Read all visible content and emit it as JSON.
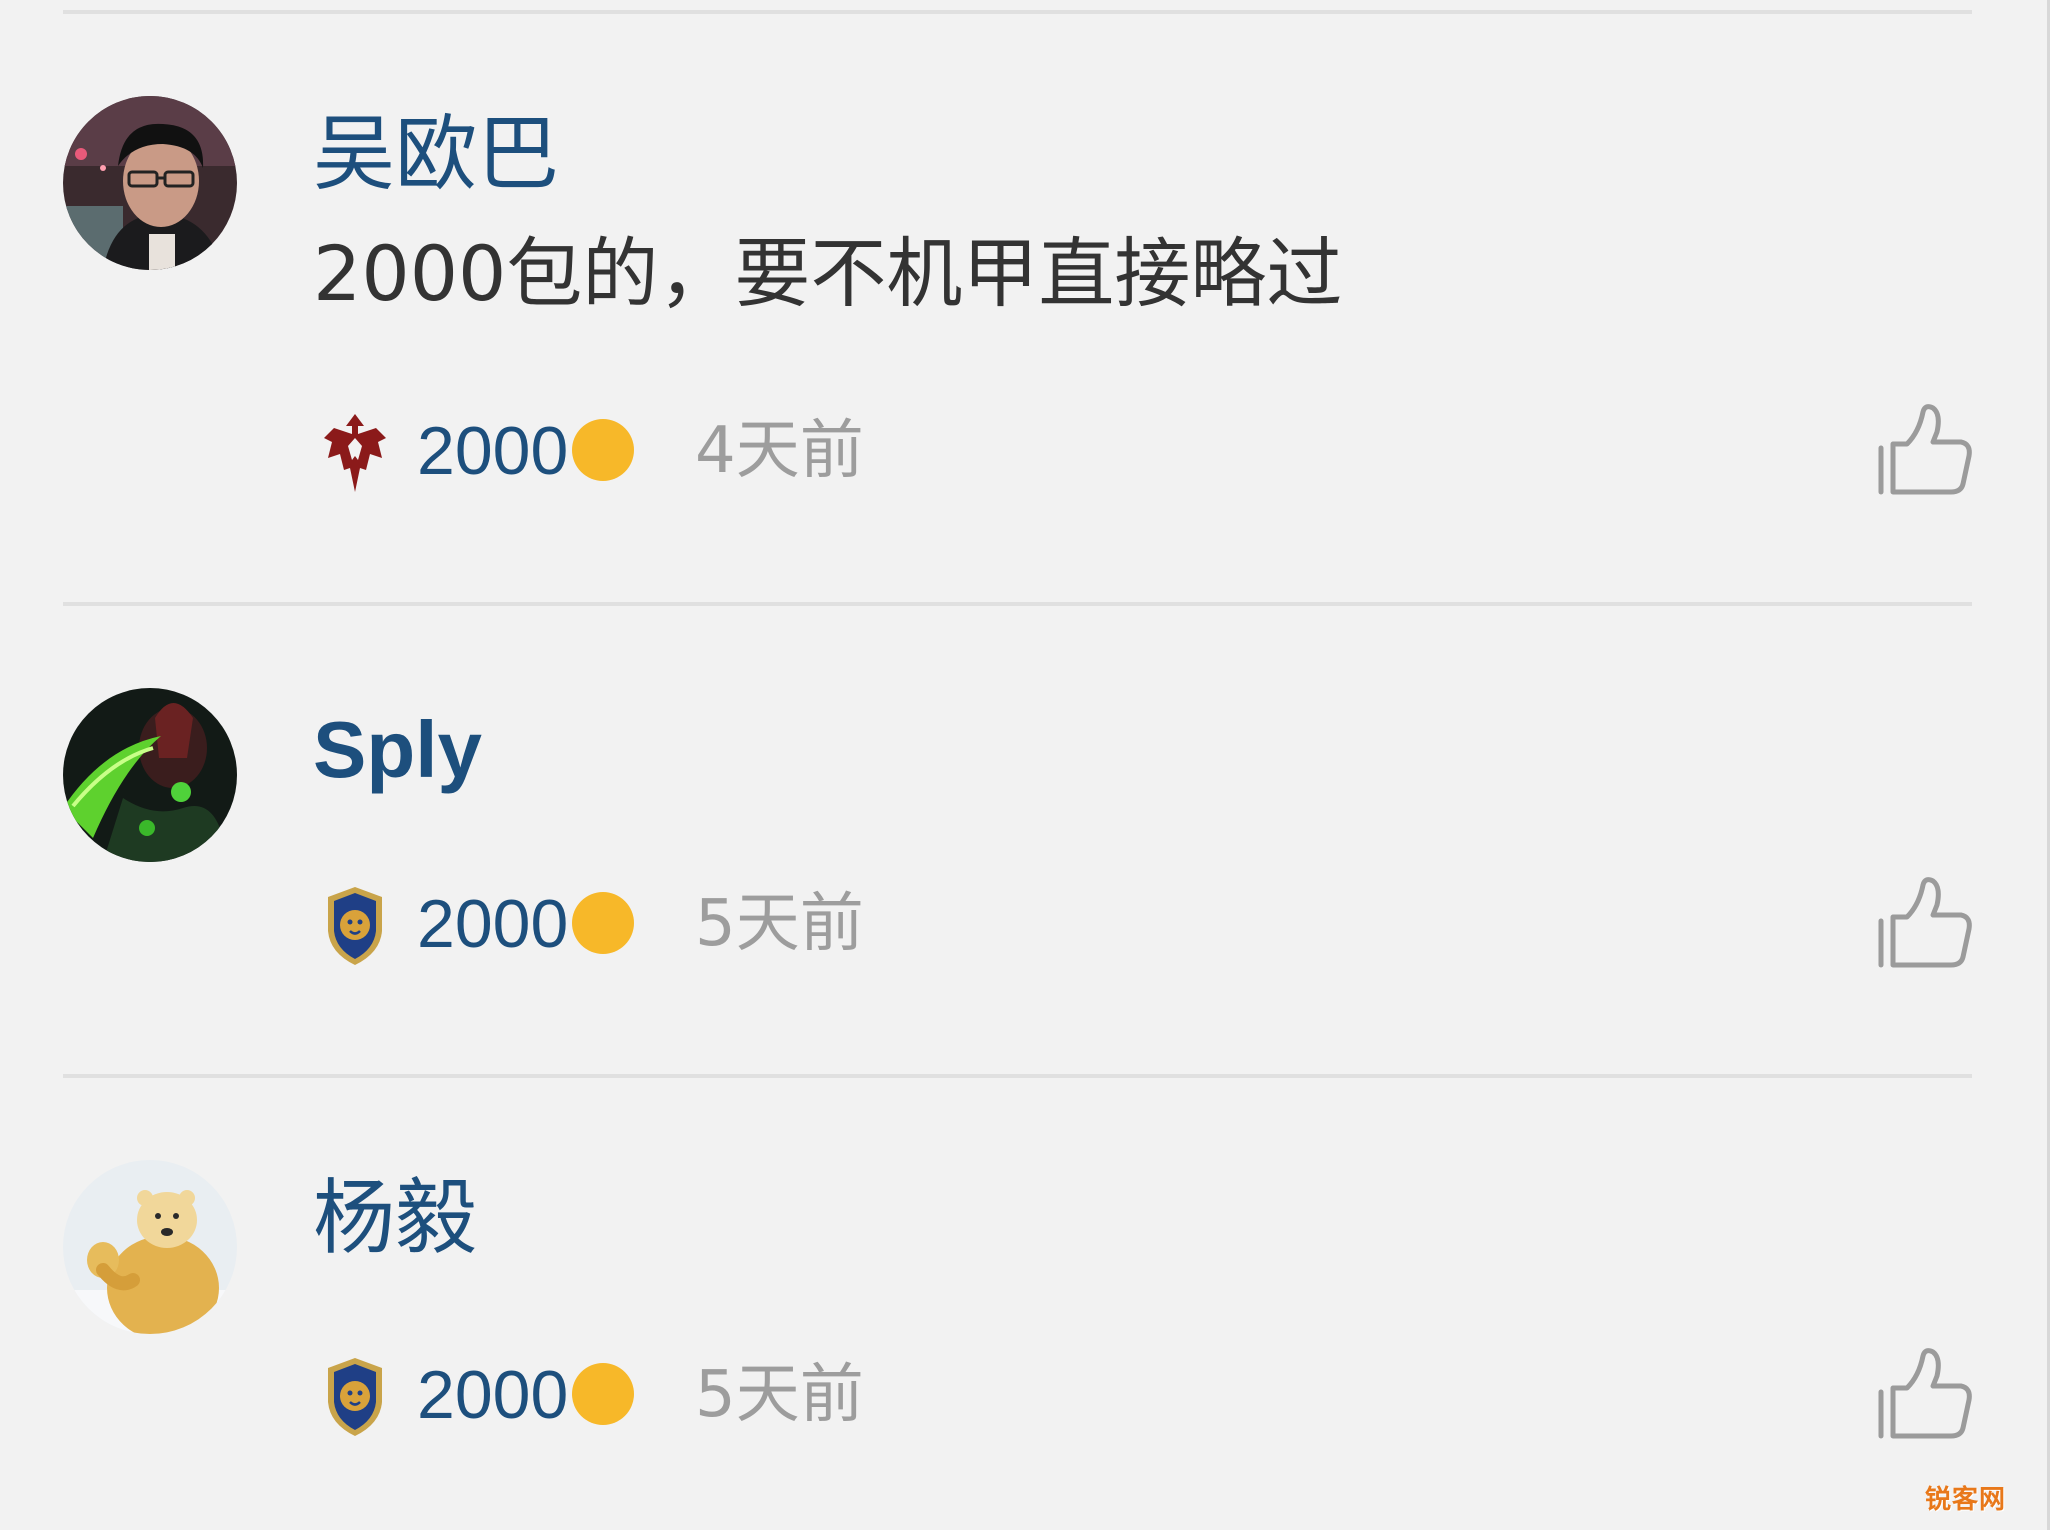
{
  "comments": [
    {
      "username": "吴欧巴",
      "text": "2000包的，要不机甲直接略过",
      "points": "2000",
      "time": "4天前",
      "faction_icon": "horde-emblem-icon"
    },
    {
      "username": "Sply",
      "text": "",
      "points": "2000",
      "time": "5天前",
      "faction_icon": "alliance-emblem-icon"
    },
    {
      "username": "杨毅",
      "text": "",
      "points": "2000",
      "time": "5天前",
      "faction_icon": "alliance-emblem-icon"
    }
  ],
  "like_icon": "thumbs-up-icon",
  "coin_icon": "gold-coin-icon",
  "colors": {
    "background": "#f2f2f2",
    "username": "#1d4f7d",
    "coin": "#f7b829",
    "horde": "#8b1a1a",
    "alliance": "#1f3f86"
  },
  "watermark": "锐客网"
}
